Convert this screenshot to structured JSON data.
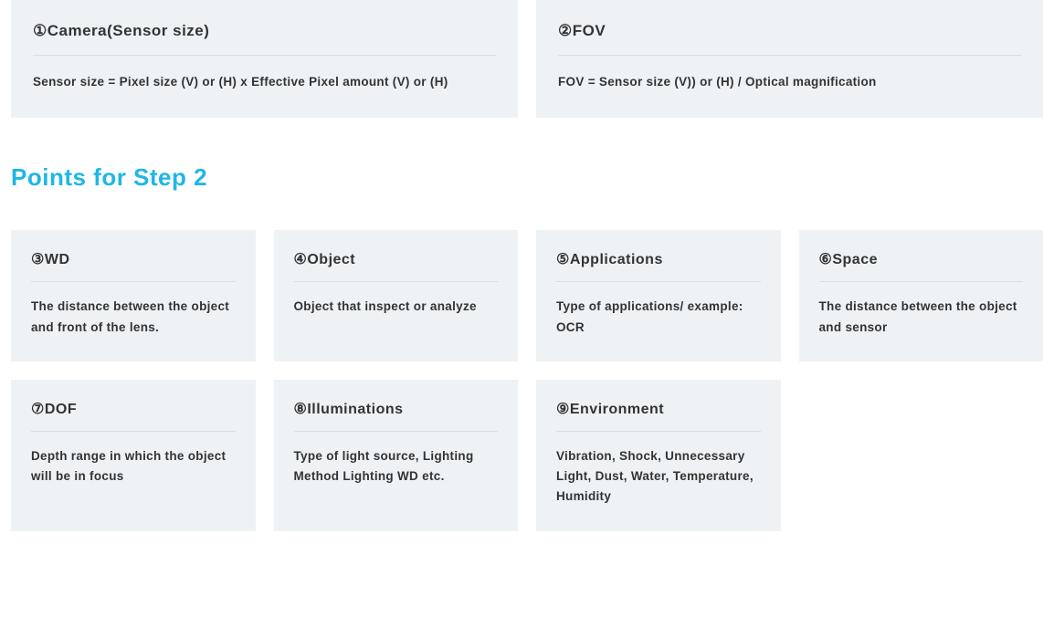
{
  "top_cards": [
    {
      "title": "①Camera(Sensor size)",
      "body": "Sensor size = Pixel size (V) or (H) x Effective Pixel amount (V) or (H)"
    },
    {
      "title": "②FOV",
      "body": "FOV = Sensor size (V)) or (H) / Optical magnification"
    }
  ],
  "section_heading": "Points for Step 2",
  "grid_cards": [
    {
      "title": "③WD",
      "body": "The distance between the object and front of the lens."
    },
    {
      "title": "④Object",
      "body": "Object that inspect or analyze"
    },
    {
      "title": "⑤Applications",
      "body": "Type of applications/ example: OCR"
    },
    {
      "title": "⑥Space",
      "body": "The distance between the object and sensor"
    },
    {
      "title": "⑦DOF",
      "body": "Depth range in which the object will be in focus"
    },
    {
      "title": "⑧Illuminations",
      "body": "Type of light source, Lighting Method Lighting WD etc."
    },
    {
      "title": "⑨Environment",
      "body": "Vibration, Shock, Unnecessary Light, Dust, Water, Temperature, Humidity"
    }
  ]
}
